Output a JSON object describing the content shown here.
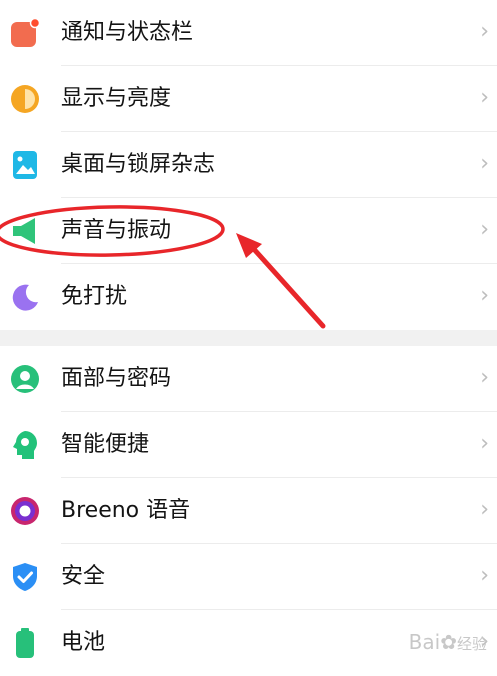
{
  "settings": {
    "items": [
      {
        "label": "通知与状态栏",
        "icon": "notification-icon"
      },
      {
        "label": "显示与亮度",
        "icon": "brightness-icon"
      },
      {
        "label": "桌面与锁屏杂志",
        "icon": "wallpaper-icon"
      },
      {
        "label": "声音与振动",
        "icon": "speaker-icon"
      },
      {
        "label": "免打扰",
        "icon": "moon-icon"
      },
      {
        "label": "面部与密码",
        "icon": "face-icon"
      },
      {
        "label": "智能便捷",
        "icon": "smart-head-icon"
      },
      {
        "label": "Breeno 语音",
        "icon": "breeno-icon"
      },
      {
        "label": "安全",
        "icon": "shield-icon"
      },
      {
        "label": "电池",
        "icon": "battery-icon"
      }
    ],
    "chevron": "›"
  },
  "watermark": {
    "brand": "Bai",
    "sub": "经验"
  },
  "colors": {
    "annotation": "#e8262a",
    "divider": "#ececec",
    "section_gap": "#f1f1f1"
  }
}
